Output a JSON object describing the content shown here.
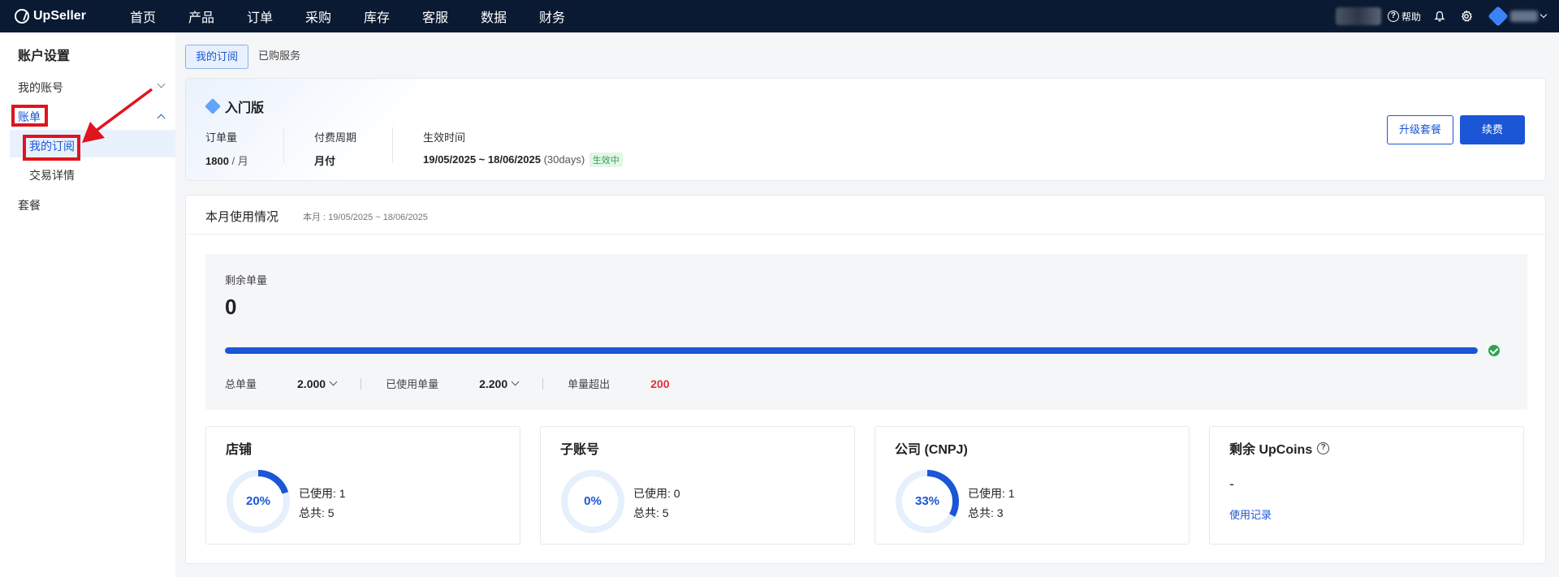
{
  "topbar": {
    "brand": "UpSeller",
    "nav": [
      "首页",
      "产品",
      "订单",
      "采购",
      "库存",
      "客服",
      "数据",
      "财务"
    ],
    "help_label": "帮助"
  },
  "sidebar": {
    "title": "账户设置",
    "items": [
      {
        "label": "我的账号"
      },
      {
        "label": "账单"
      },
      {
        "label": "我的订阅"
      },
      {
        "label": "交易详情"
      },
      {
        "label": "套餐"
      }
    ]
  },
  "tabs": [
    {
      "label": "我的订阅",
      "active": true
    },
    {
      "label": "已购服务",
      "active": false
    }
  ],
  "plan": {
    "name": "入门版",
    "order_qty_label": "订单量",
    "order_qty_value": "1800",
    "order_qty_unit": " / 月",
    "billing_label": "付费周期",
    "billing_value": "月付",
    "effective_label": "生效时间",
    "effective_range": "19/05/2025 ~ 18/06/2025",
    "effective_days": " (30days)",
    "status_tag": "生效中",
    "upgrade_button": "升级套餐",
    "renew_button": "续费"
  },
  "usage": {
    "title": "本月使用情况",
    "range": "本月 : 19/05/2025 ~ 18/06/2025",
    "remaining_label": "剩余单量",
    "remaining_value": "0",
    "progress_fraction": 1.0,
    "total_label": "总单量",
    "total_value": "2.000",
    "used_label": "已使用单量",
    "used_value": "2.200",
    "overage_label": "单量超出",
    "overage_value": "200"
  },
  "cards": [
    {
      "title": "店铺",
      "percent_text": "20%",
      "percent": 0.2,
      "used_label": "已使用: ",
      "used": "1",
      "total_label": "总共: ",
      "total": "5"
    },
    {
      "title": "子账号",
      "percent_text": "0%",
      "percent": 0.0,
      "used_label": "已使用: ",
      "used": "0",
      "total_label": "总共: ",
      "total": "5"
    },
    {
      "title": "公司 (CNPJ)",
      "percent_text": "33%",
      "percent": 0.33,
      "used_label": "已使用: ",
      "used": "1",
      "total_label": "总共: ",
      "total": "3"
    }
  ],
  "upcoins": {
    "title": "剩余 UpCoins",
    "value": "-",
    "link": "使用记录"
  },
  "colors": {
    "primary": "#1a56d6",
    "topbar": "#0b1a33",
    "danger": "#e0303e",
    "success": "#2ea44f",
    "annotation_red": "#e0141e"
  }
}
